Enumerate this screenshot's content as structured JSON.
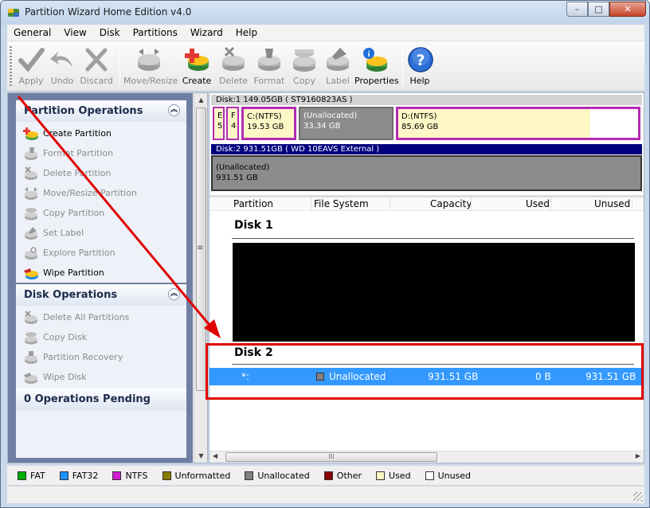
{
  "window": {
    "title": "Partition Wizard Home Edition v4.0",
    "min_label": "–",
    "max_label": "□",
    "close_label": "✕"
  },
  "menu": [
    "General",
    "View",
    "Disk",
    "Partitions",
    "Wizard",
    "Help"
  ],
  "toolbar": {
    "apply": "Apply",
    "undo": "Undo",
    "discard": "Discard",
    "move_resize": "Move/Resize",
    "create": "Create",
    "delete": "Delete",
    "format": "Format",
    "copy": "Copy",
    "label": "Label",
    "properties": "Properties",
    "help": "Help"
  },
  "partition_ops": {
    "header": "Partition Operations",
    "items": [
      "Create Partition",
      "Format Partition",
      "Delete Partition",
      "Move/Resize Partition",
      "Copy Partition",
      "Set Label",
      "Explore Partition",
      "Wipe Partition"
    ]
  },
  "disk_ops": {
    "header": "Disk Operations",
    "items": [
      "Delete All Partitions",
      "Copy Disk",
      "Partition Recovery",
      "Wipe Disk"
    ]
  },
  "pending": {
    "header": "0 Operations Pending"
  },
  "disk_map": {
    "disk1": {
      "header": "Disk:1 149.05GB  ( ST9160823AS )",
      "parts": [
        {
          "l1": "E",
          "l2": "5"
        },
        {
          "l1": "F",
          "l2": "4"
        },
        {
          "l1": "C:(NTFS)",
          "l2": "19.53 GB"
        },
        {
          "l1": "(Unallocated)",
          "l2": "33.34 GB"
        },
        {
          "l1": "D:(NTFS)",
          "l2": "85.69 GB"
        }
      ]
    },
    "disk2": {
      "header": "Disk:2 931.51GB  ( WD 10EAVS External )",
      "part": {
        "l1": "(Unallocated)",
        "l2": "931.51 GB"
      }
    }
  },
  "list": {
    "columns": [
      "Partition",
      "File System",
      "Capacity",
      "Used",
      "Unused"
    ],
    "disk1_label": "Disk 1",
    "disk2_label": "Disk 2",
    "selected_row": {
      "partition": "*:",
      "file_system": "Unallocated",
      "capacity": "931.51 GB",
      "used": "0 B",
      "unused": "931.51 GB"
    }
  },
  "scroll": {
    "hthumb_grip": "III",
    "vgrip": "≡"
  },
  "legend": [
    {
      "label": "FAT",
      "color": "#00b000"
    },
    {
      "label": "FAT32",
      "color": "#1e90ff"
    },
    {
      "label": "NTFS",
      "color": "#d21ed2"
    },
    {
      "label": "Unformatted",
      "color": "#8b7d00"
    },
    {
      "label": "Unallocated",
      "color": "#808080"
    },
    {
      "label": "Other",
      "color": "#8b0000"
    },
    {
      "label": "Used",
      "color": "#fdf8c6"
    },
    {
      "label": "Unused",
      "color": "#ffffff"
    }
  ],
  "colors": {
    "ntfs_border": "#b42bb4",
    "annotation_red": "#e00000",
    "selection": "#3399ff"
  }
}
